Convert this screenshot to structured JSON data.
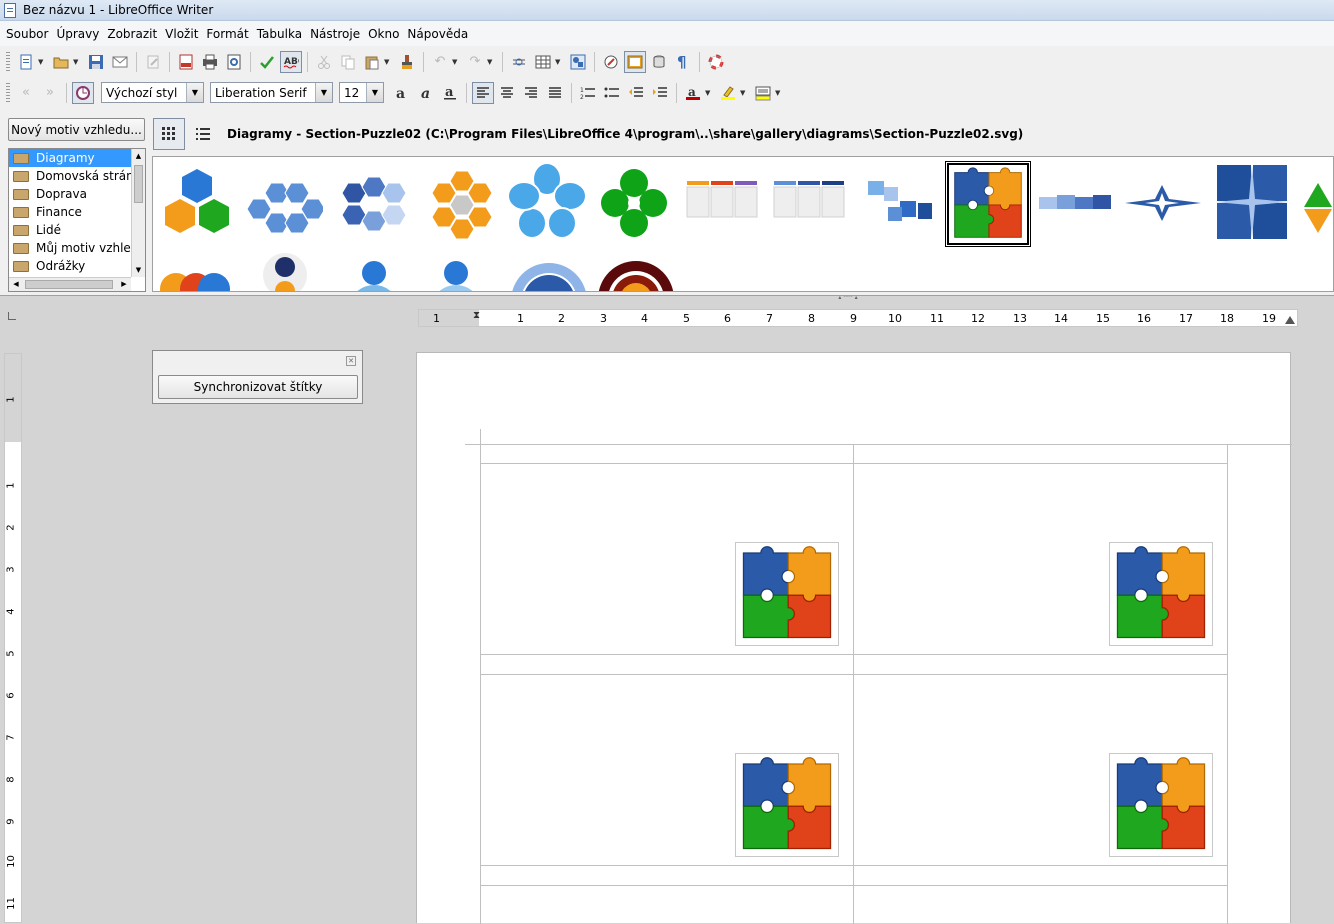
{
  "window": {
    "title": "Bez názvu 1 - LibreOffice Writer"
  },
  "menu": [
    "Soubor",
    "Úpravy",
    "Zobrazit",
    "Vložit",
    "Formát",
    "Tabulka",
    "Nástroje",
    "Okno",
    "Nápověda"
  ],
  "format_bar": {
    "paragraph_style": "Výchozí styl",
    "font_name": "Liberation Serif",
    "font_size": "12"
  },
  "gallery": {
    "new_theme_button": "Nový motiv vzhledu...",
    "path": "Diagramy - Section-Puzzle02 (C:\\Program Files\\LibreOffice 4\\program\\..\\share\\gallery\\diagrams\\Section-Puzzle02.svg)",
    "themes": [
      "Diagramy",
      "Domovská stránka",
      "Doprava",
      "Finance",
      "Lidé",
      "Můj motiv vzhledu",
      "Odrážky"
    ],
    "selected_theme": "Diagramy"
  },
  "ruler": {
    "h_labels": [
      "1",
      "1",
      "2",
      "3",
      "4",
      "5",
      "6",
      "7",
      "8",
      "9",
      "10",
      "11",
      "12",
      "13",
      "14",
      "15",
      "16",
      "17",
      "18",
      "19"
    ],
    "v_labels": [
      "1",
      "1",
      "2",
      "3",
      "4",
      "5",
      "6",
      "7",
      "8",
      "9",
      "10",
      "11"
    ]
  },
  "labels_panel": {
    "sync_button": "Synchronizovat štítky"
  },
  "colors": {
    "puzzle_blue": "#2a5aa8",
    "puzzle_orange": "#f39c1b",
    "puzzle_green": "#1fa81f",
    "puzzle_red": "#e0421a",
    "selection": "#3399ff"
  }
}
